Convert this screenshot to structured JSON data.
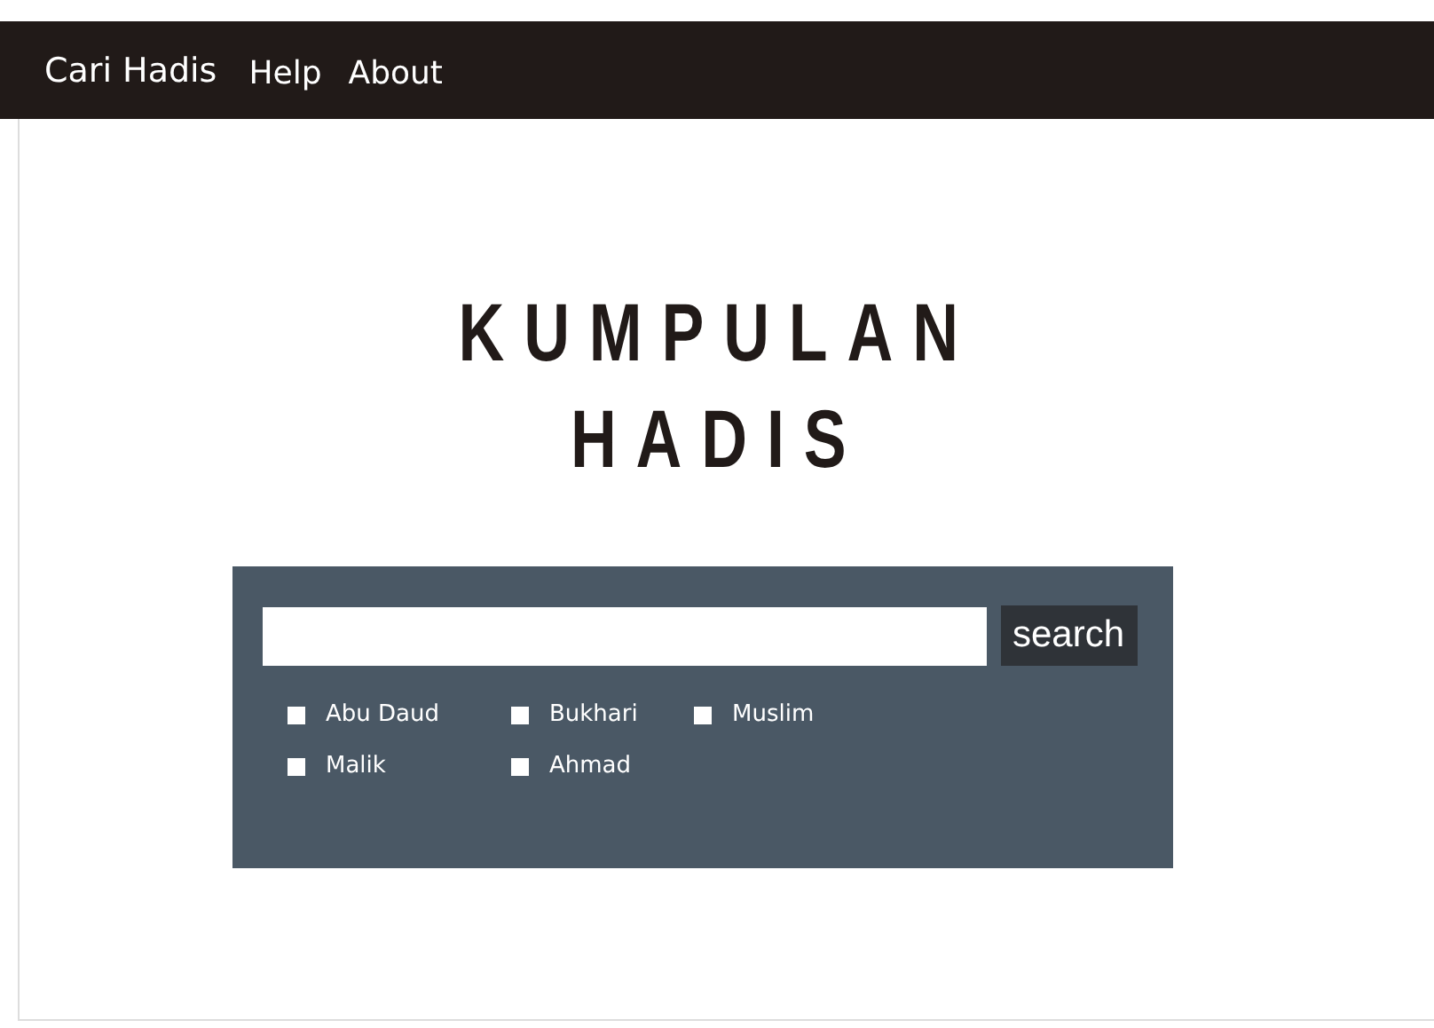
{
  "navbar": {
    "brand": "Cari Hadis",
    "links": [
      "Help",
      "About"
    ]
  },
  "title": [
    "KUMPULAN",
    "HADIS"
  ],
  "search": {
    "button": "search"
  },
  "options": [
    {
      "label": "Abu Daud",
      "checked": false
    },
    {
      "label": "Bukhari",
      "checked": false
    },
    {
      "label": "Muslim",
      "checked": false
    },
    {
      "label": "Malik",
      "checked": false
    },
    {
      "label": "Ahmad",
      "checked": false
    }
  ]
}
